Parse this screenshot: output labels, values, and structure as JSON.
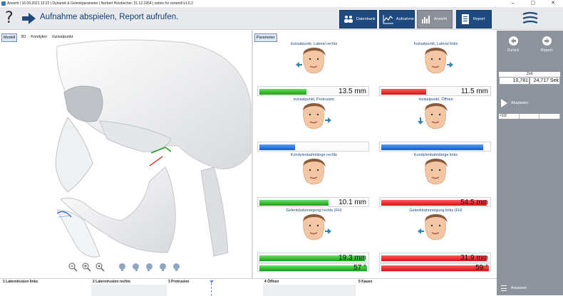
{
  "window": {
    "title": "Ansicht | 16.09.2021 12:22 | Dynamik & Gelenkparameter | Norbert Holzbecher, 21.12.1954 | zebris for ceramill v1.0.2",
    "controls": [
      "–",
      "▢",
      "✕"
    ]
  },
  "header": {
    "help": "?",
    "instruction": "Aufnahme abspielen, Report aufrufen.",
    "buttons": [
      {
        "label": "Datenbank",
        "icon": "database-icon",
        "active": false
      },
      {
        "label": "Aufnahme",
        "icon": "recording-icon",
        "active": false
      },
      {
        "label": "Ansicht",
        "icon": "view-chart-icon",
        "active": true
      },
      {
        "label": "Report",
        "icon": "report-icon",
        "active": false
      }
    ]
  },
  "view_tabs": [
    "Modell",
    "3D",
    "Kondylen",
    "Inzisalpunkt"
  ],
  "parameter_tab": "Parameter",
  "parameters": [
    {
      "title": "Inzisalpunkt, Lateral rechts",
      "value": "13.5 mm",
      "color": "#1a9e1a",
      "fill": 0.44
    },
    {
      "title": "Inzisalpunkt, Lateral links",
      "value": "11.5 mm",
      "color": "#d21414",
      "fill": 0.42
    },
    {
      "title": "Inzisalpunkt, Protrusion",
      "value": "",
      "color": "#1257d6",
      "fill": 0.33
    },
    {
      "title": "Inzisalpunkt, Öffnen",
      "value": "",
      "color": "#1257d6",
      "fill": 0.95
    },
    {
      "title": "Kondylenbahnlänge rechts",
      "value": "10.1 mm",
      "color": "#1a9e1a",
      "fill": 0.64
    },
    {
      "title": "Kondylenbahnlänge links",
      "value": "54.5 mm",
      "color": "#d21414",
      "fill": 0.98
    },
    {
      "title": "Gelenkbahnneigung rechts (FH)",
      "value": "19.3 mm",
      "color": "#1a9e1a",
      "fill": 0.98
    },
    {
      "title": "Gelenkbahnneigung links (FH)",
      "value": "31.9 mm",
      "color": "#d21414",
      "fill": 0.98
    }
  ],
  "bottom_values": [
    "57 °",
    "59 °"
  ],
  "side": {
    "back_label": "Zurück",
    "report_label": "Report",
    "zeit_label": "Zeit",
    "zeit_values": [
      "10,781",
      "24,717 Sek"
    ],
    "play_label": "Abspielen",
    "speed": [
      "×1/2",
      "",
      ""
    ],
    "anpassen_label": "Anpassen"
  },
  "timeline": [
    "1 Laterotrusion links",
    "2 Laterotrusion rechts",
    "3 Protrusion",
    "4 Öffnen",
    "5 Kauen"
  ]
}
